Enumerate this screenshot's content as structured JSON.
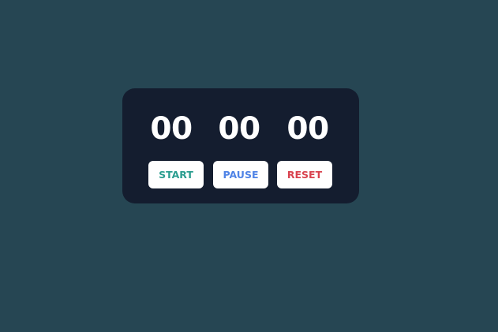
{
  "timer": {
    "hours": "00",
    "minutes": "00",
    "seconds": "00"
  },
  "controls": {
    "start_label": "START",
    "pause_label": "PAUSE",
    "reset_label": "RESET"
  },
  "colors": {
    "background": "#264653",
    "panel": "#141d2f",
    "digits": "#ffffff",
    "start": "#2a9d8f",
    "pause": "#4f83e6",
    "reset": "#d9434f",
    "button_bg": "#ffffff"
  }
}
